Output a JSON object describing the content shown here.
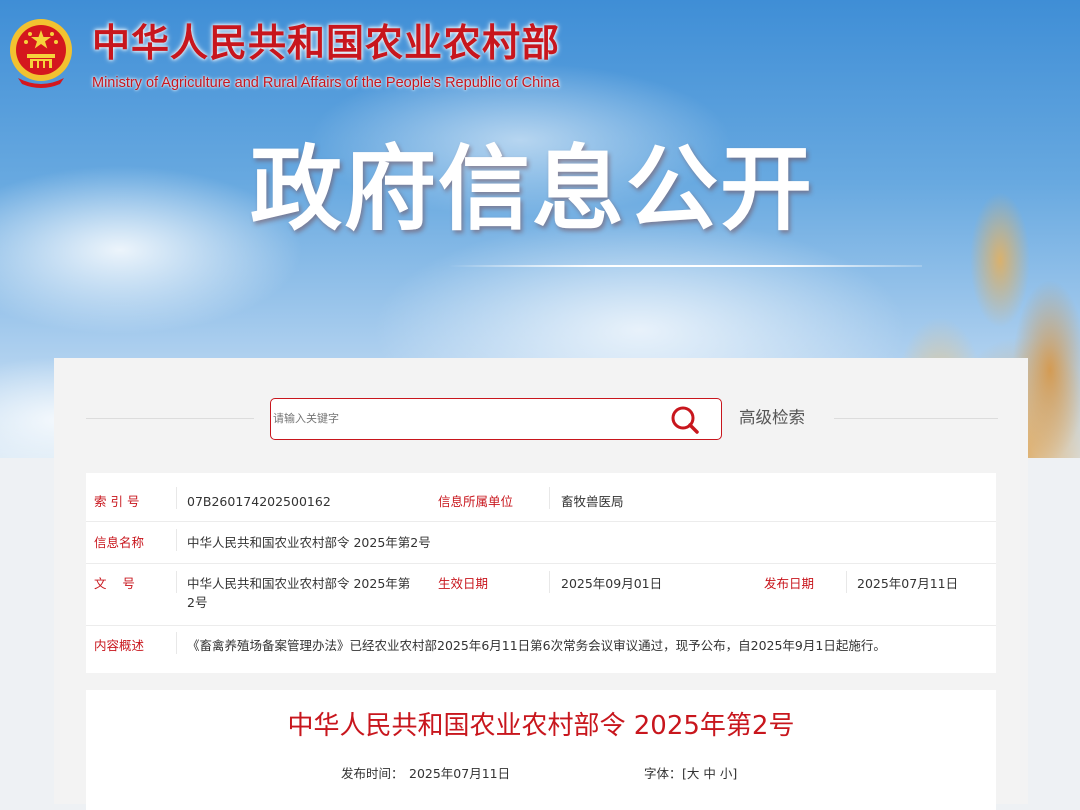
{
  "header": {
    "site_title": "中华人民共和国农业农村部",
    "site_subtitle": "Ministry of Agriculture and Rural Affairs of the People's Republic of China",
    "banner_title": "政府信息公开",
    "emblem_icon": "national-emblem-icon"
  },
  "search": {
    "placeholder": "请输入关键字",
    "advanced_label": "高级检索",
    "icon": "search-icon"
  },
  "meta": {
    "index_label": "索 引 号",
    "index_value": "07B260174202500162",
    "unit_label": "信息所属单位",
    "unit_value": "畜牧兽医局",
    "name_label": "信息名称",
    "name_value": "中华人民共和国农业农村部令 2025年第2号",
    "doc_label": "文    号",
    "doc_value_line1": "中华人民共和国农业农村部令 2025年第",
    "doc_value_line2": "2号",
    "effective_label": "生效日期",
    "effective_value": "2025年09月01日",
    "publish_label": "发布日期",
    "publish_value": "2025年07月11日",
    "summary_label": "内容概述",
    "summary_value": "《畜禽养殖场备案管理办法》已经农业农村部2025年6月11日第6次常务会议审议通过，现予公布，自2025年9月1日起施行。"
  },
  "article": {
    "title": "中华人民共和国农业农村部令 2025年第2号",
    "pub_time_label": "发布时间：",
    "pub_time_value": "2025年07月11日",
    "font_label": "字体：",
    "font_size_options": "[大 中 小]"
  },
  "colors": {
    "accent": "#c8161d",
    "panel_bg": "#f3f3f3"
  }
}
